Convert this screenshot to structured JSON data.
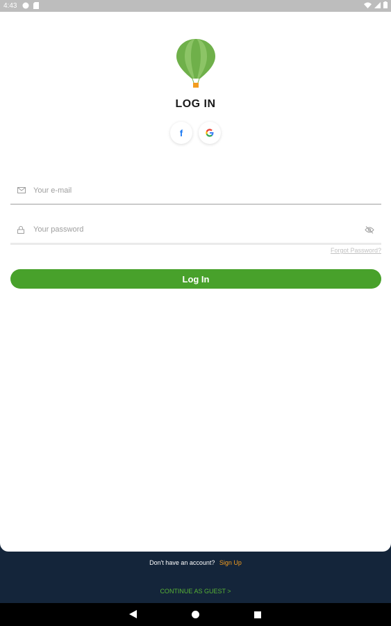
{
  "status_bar": {
    "time": "4:43"
  },
  "auth": {
    "title": "LOG IN",
    "social": {
      "facebook_glyph": "f",
      "google_glyph": "G"
    },
    "email": {
      "placeholder": "Your e-mail",
      "icon": "mail-icon"
    },
    "password": {
      "placeholder": "Your password",
      "icon": "lock-icon",
      "toggle_icon": "eye-off-icon"
    },
    "forgot_label": "Forgot Password?",
    "login_label": "Log In"
  },
  "footer": {
    "no_account_text": "Don't have an account?",
    "signup_label": "Sign Up",
    "guest_label": "CONTINUE AS GUEST  >"
  },
  "colors": {
    "accent_green": "#48a12b",
    "signup_orange": "#f29c1f",
    "footer_navy": "#14253a"
  }
}
